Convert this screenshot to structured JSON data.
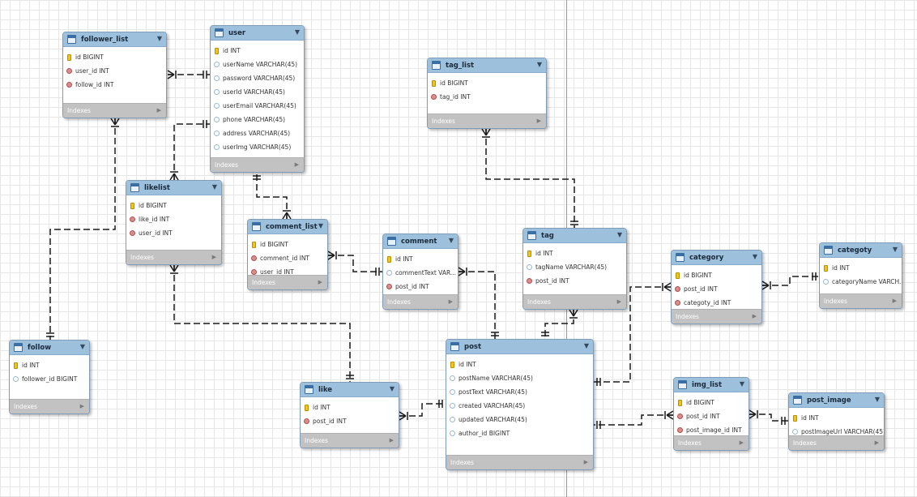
{
  "entities": [
    {
      "id": "follower_list",
      "name": "follower_list",
      "columns": [
        {
          "text": "id BIGINT",
          "type": "pk"
        },
        {
          "text": "user_id INT",
          "type": "fk"
        },
        {
          "text": "follow_id INT",
          "type": "fk"
        }
      ],
      "footer": "Indexes"
    },
    {
      "id": "user",
      "name": "user",
      "columns": [
        {
          "text": "id INT",
          "type": "pk"
        },
        {
          "text": "userName VARCHAR(45)",
          "type": "col"
        },
        {
          "text": "password VARCHAR(45)",
          "type": "col"
        },
        {
          "text": "userId VARCHAR(45)",
          "type": "col"
        },
        {
          "text": "userEmail VARCHAR(45)",
          "type": "col"
        },
        {
          "text": "phone VARCHAR(45)",
          "type": "col"
        },
        {
          "text": "address VARCHAR(45)",
          "type": "col"
        },
        {
          "text": "userImg VARCHAR(45)",
          "type": "col"
        }
      ],
      "footer": "Indexes"
    },
    {
      "id": "tag_list",
      "name": "tag_list",
      "columns": [
        {
          "text": "id BIGINT",
          "type": "pk"
        },
        {
          "text": "tag_id INT",
          "type": "fk"
        }
      ],
      "footer": "Indexes"
    },
    {
      "id": "likelist",
      "name": "likelist",
      "columns": [
        {
          "text": "id BIGINT",
          "type": "pk"
        },
        {
          "text": "like_id INT",
          "type": "fk"
        },
        {
          "text": "user_id INT",
          "type": "fk"
        }
      ],
      "footer": "Indexes"
    },
    {
      "id": "comment_list",
      "name": "comment_list",
      "columns": [
        {
          "text": "id BIGINT",
          "type": "pk"
        },
        {
          "text": "comment_id INT",
          "type": "fk"
        },
        {
          "text": "user_id INT",
          "type": "fk"
        }
      ],
      "footer": "Indexes"
    },
    {
      "id": "comment",
      "name": "comment",
      "columns": [
        {
          "text": "id INT",
          "type": "pk"
        },
        {
          "text": "commentText VAR...",
          "type": "col"
        },
        {
          "text": "post_id INT",
          "type": "fk"
        }
      ],
      "footer": "Indexes"
    },
    {
      "id": "tag",
      "name": "tag",
      "columns": [
        {
          "text": "id INT",
          "type": "pk"
        },
        {
          "text": "tagName VARCHAR(45)",
          "type": "col"
        },
        {
          "text": "post_id INT",
          "type": "fk"
        }
      ],
      "footer": "Indexes"
    },
    {
      "id": "category",
      "name": "category",
      "columns": [
        {
          "text": "id BIGINT",
          "type": "pk"
        },
        {
          "text": "post_id INT",
          "type": "fk"
        },
        {
          "text": "categoty_id INT",
          "type": "fk"
        }
      ],
      "footer": "Indexes"
    },
    {
      "id": "categoty",
      "name": "categoty",
      "columns": [
        {
          "text": "id INT",
          "type": "pk"
        },
        {
          "text": "categoryName VARCH...",
          "type": "col"
        }
      ],
      "footer": "Indexes"
    },
    {
      "id": "follow",
      "name": "follow",
      "columns": [
        {
          "text": "id INT",
          "type": "pk"
        },
        {
          "text": "follower_id BIGINT",
          "type": "col"
        }
      ],
      "footer": "Indexes"
    },
    {
      "id": "like",
      "name": "like",
      "columns": [
        {
          "text": "id INT",
          "type": "pk"
        },
        {
          "text": "post_id INT",
          "type": "fk"
        }
      ],
      "footer": "Indexes"
    },
    {
      "id": "post",
      "name": "post",
      "columns": [
        {
          "text": "id INT",
          "type": "pk"
        },
        {
          "text": "postName VARCHAR(45)",
          "type": "col"
        },
        {
          "text": "postText VARCHAR(45)",
          "type": "col"
        },
        {
          "text": "created VARCHAR(45)",
          "type": "col"
        },
        {
          "text": "updated VARCHAR(45)",
          "type": "col"
        },
        {
          "text": "author_id BIGINT",
          "type": "col"
        }
      ],
      "footer": "Indexes"
    },
    {
      "id": "img_list",
      "name": "img_list",
      "columns": [
        {
          "text": "id BIGINT",
          "type": "pk"
        },
        {
          "text": "post_id INT",
          "type": "fk"
        },
        {
          "text": "post_image_id INT",
          "type": "fk"
        }
      ],
      "footer": "Indexes"
    },
    {
      "id": "post_image",
      "name": "post_image",
      "columns": [
        {
          "text": "id INT",
          "type": "pk"
        },
        {
          "text": "postImageUrl VARCHAR(45)",
          "type": "col"
        }
      ],
      "footer": "Indexes"
    }
  ],
  "relationships": [
    {
      "from": "follower_list",
      "to": "user"
    },
    {
      "from": "follower_list",
      "to": "follow"
    },
    {
      "from": "likelist",
      "to": "user"
    },
    {
      "from": "likelist",
      "to": "like"
    },
    {
      "from": "comment_list",
      "to": "user"
    },
    {
      "from": "comment_list",
      "to": "comment"
    },
    {
      "from": "comment",
      "to": "post"
    },
    {
      "from": "tag_list",
      "to": "tag"
    },
    {
      "from": "tag",
      "to": "post"
    },
    {
      "from": "category",
      "to": "post"
    },
    {
      "from": "category",
      "to": "categoty"
    },
    {
      "from": "like",
      "to": "post"
    },
    {
      "from": "img_list",
      "to": "post"
    },
    {
      "from": "img_list",
      "to": "post_image"
    }
  ]
}
